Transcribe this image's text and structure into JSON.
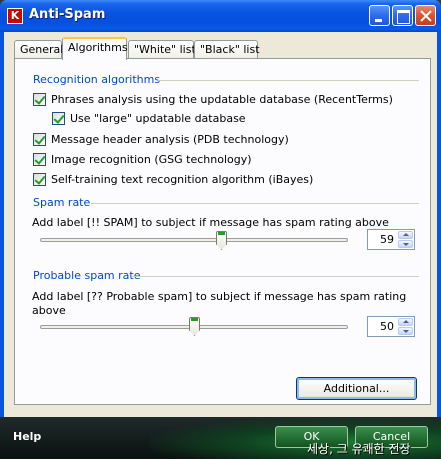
{
  "window": {
    "title": "Anti-Spam",
    "logo_letter": "K"
  },
  "tabs": [
    "General",
    "Algorithms",
    "\"White\" list",
    "\"Black\" list"
  ],
  "recognition": {
    "heading": "Recognition algorithms",
    "items": [
      {
        "label": "Phrases analysis using the updatable database (RecentTerms)",
        "checked": true
      },
      {
        "label": "Use \"large\" updatable database",
        "checked": true
      },
      {
        "label": "Message header analysis (PDB technology)",
        "checked": true
      },
      {
        "label": "Image recognition (GSG technology)",
        "checked": true
      },
      {
        "label": "Self-training text recognition algorithm (iBayes)",
        "checked": true
      }
    ]
  },
  "spam_rate": {
    "heading": "Spam rate",
    "description": "Add label [!! SPAM] to subject if message has spam rating above",
    "value": "59",
    "level": 0.59
  },
  "probable_spam_rate": {
    "heading": "Probable spam rate",
    "description_line1": "Add label [?? Probable spam] to subject if message has spam rating",
    "description_line2": "above",
    "value": "50",
    "level": 0.5
  },
  "additional_button": "Additional...",
  "footer": {
    "help": "Help",
    "ok": "OK",
    "cancel": "Cancel"
  },
  "watermark": "세상, 그 유쾌한 전장"
}
